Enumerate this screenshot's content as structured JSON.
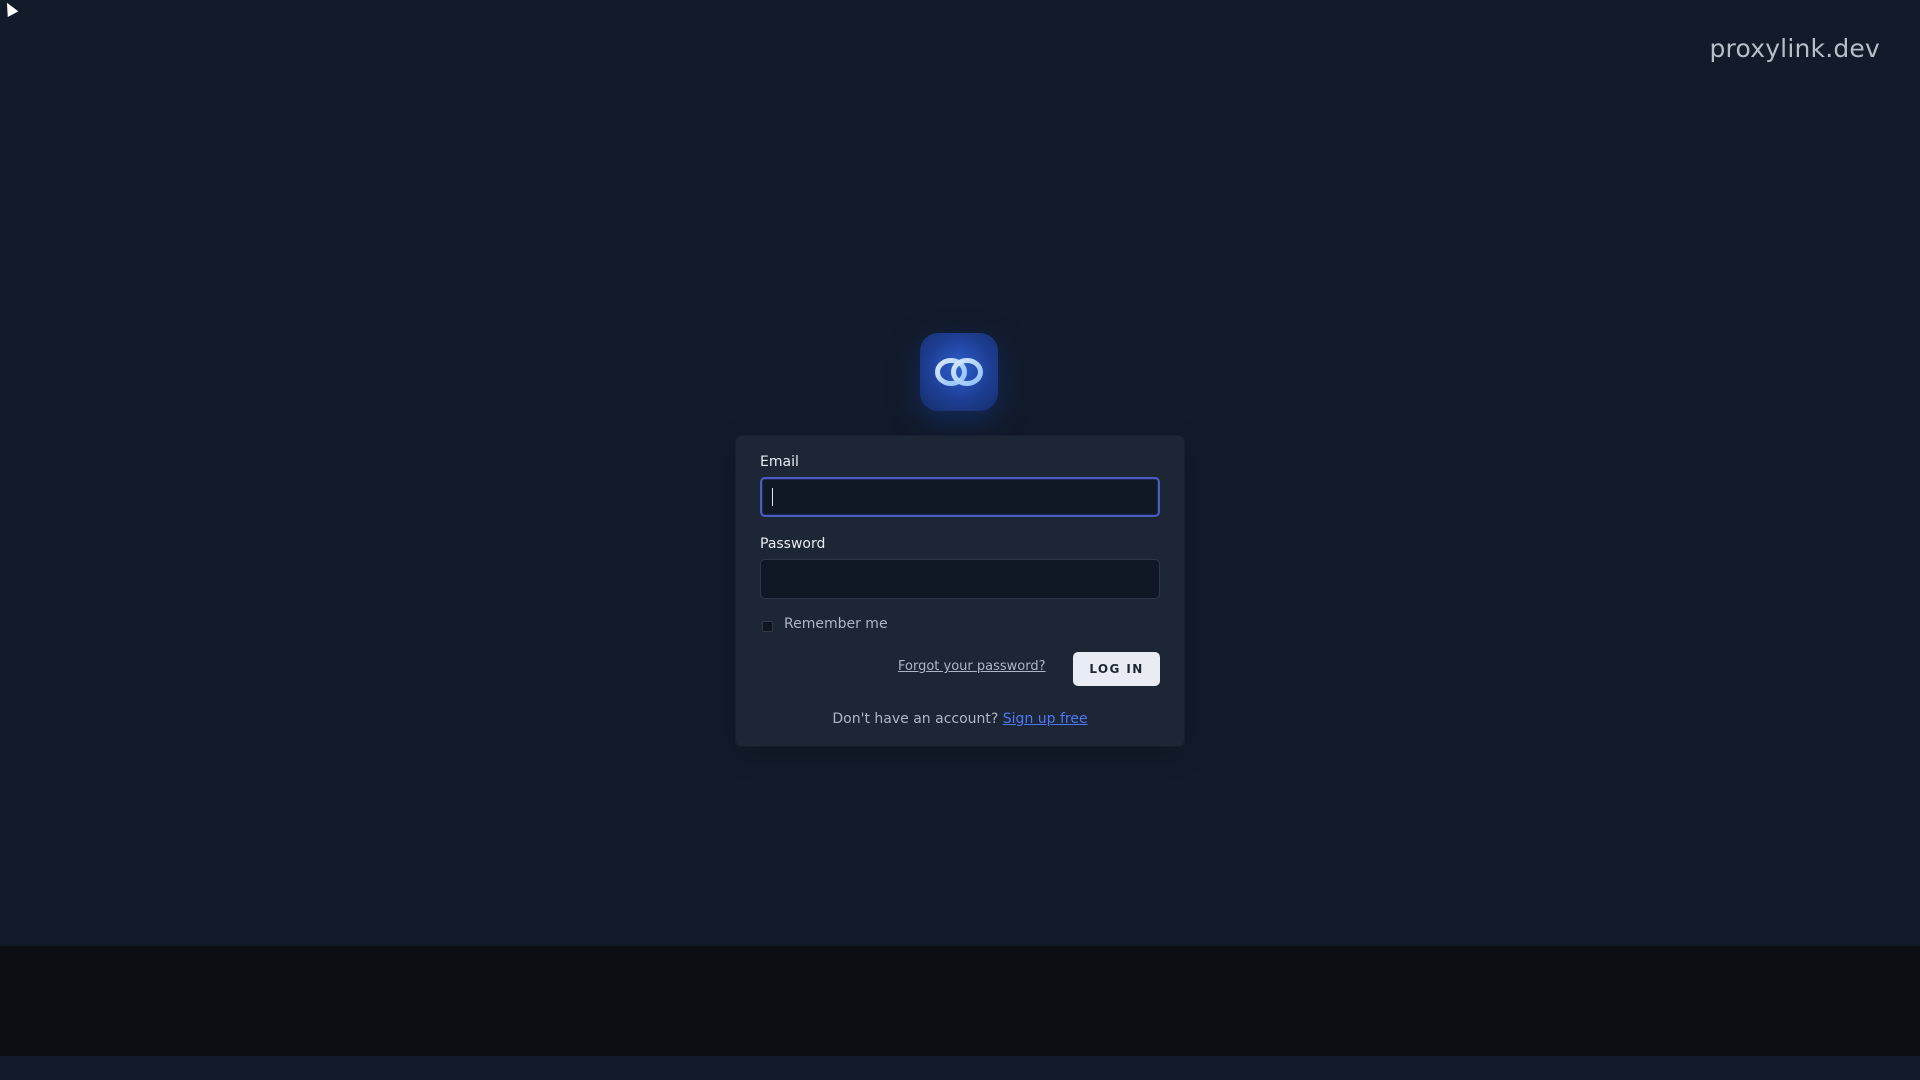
{
  "brand": {
    "domain": "proxylink.dev",
    "logo_icon": "double-ring-logo-icon",
    "accent_color": "#2e5fcf"
  },
  "login": {
    "email_label": "Email",
    "email_value": "",
    "email_placeholder": "",
    "password_label": "Password",
    "password_value": "",
    "password_placeholder": "",
    "remember_label": "Remember me",
    "forgot_password": "Forgot your password?",
    "submit_label": "LOG IN",
    "signup_prompt": "Don't have an account?",
    "signup_link": "Sign up free"
  }
}
